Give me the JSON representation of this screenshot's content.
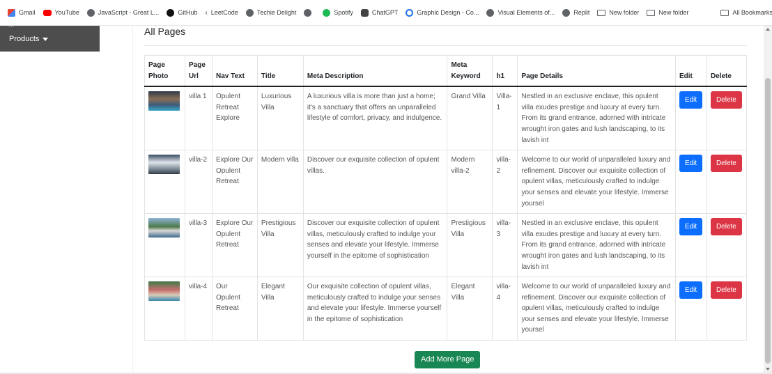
{
  "bookmarks": [
    {
      "label": "Gmail",
      "icon": "gmail-icon"
    },
    {
      "label": "YouTube",
      "icon": "youtube-icon"
    },
    {
      "label": "JavaScript - Great L...",
      "icon": "globe-icon"
    },
    {
      "label": "GitHub",
      "icon": "github-icon"
    },
    {
      "label": "LeetCode",
      "icon": "leetcode-icon"
    },
    {
      "label": "Techie Delight",
      "icon": "globe-icon"
    },
    {
      "label": "",
      "icon": "globe-icon"
    },
    {
      "label": "Spotify",
      "icon": "spotify-icon"
    },
    {
      "label": "ChatGPT",
      "icon": "chatgpt-icon"
    },
    {
      "label": "Graphic Design - Co...",
      "icon": "globe-icon"
    },
    {
      "label": "Visual Elements of...",
      "icon": "globe-icon"
    },
    {
      "label": "Replit",
      "icon": "globe-icon"
    },
    {
      "label": "New folder",
      "icon": "folder-icon"
    },
    {
      "label": "New folder",
      "icon": "folder-icon"
    }
  ],
  "all_bookmarks": "All Bookmarks",
  "sidebar": {
    "clipped_text": "...",
    "products_label": "Products"
  },
  "page": {
    "title": "All Pages",
    "add_button": "Add More Page"
  },
  "table": {
    "headers": {
      "photo": "Page Photo",
      "url": "Page Url",
      "nav": "Nav Text",
      "title": "Title",
      "meta_desc": "Meta Description",
      "meta_kw": "Meta Keyword",
      "h1": "h1",
      "details": "Page Details",
      "edit": "Edit",
      "delete": "Delete"
    },
    "rows": [
      {
        "url": "villa 1",
        "nav": "Opulent Retreat Explore",
        "title": "Luxurious Villa",
        "meta_desc": "A luxurious villa is more than just a home; it's a sanctuary that offers an unparalleled lifestyle of comfort, privacy, and indulgence.",
        "meta_kw": "Grand Villa",
        "h1": "Villa-1",
        "details": "Nestled in an exclusive enclave, this opulent villa exudes prestige and luxury at every turn. From its grand entrance, adorned with intricate wrought iron gates and lush landscaping, to its lavish int",
        "edit": "Edit",
        "delete": "Delete"
      },
      {
        "url": "villa-2",
        "nav": "Explore Our Opulent Retreat",
        "title": "Modern villa",
        "meta_desc": "Discover our exquisite collection of opulent villas.",
        "meta_kw": "Modern villa-2",
        "h1": "villa-2",
        "details": "Welcome to our world of unparalleled luxury and refinement. Discover our exquisite collection of opulent villas, meticulously crafted to indulge your senses and elevate your lifestyle. Immerse yoursel",
        "edit": "Edit",
        "delete": "Delete"
      },
      {
        "url": "villa-3",
        "nav": "Explore Our Opulent Retreat",
        "title": "Prestigious Villa",
        "meta_desc": "Discover our exquisite collection of opulent villas, meticulously crafted to indulge your senses and elevate your lifestyle. Immerse yourself in the epitome of sophistication",
        "meta_kw": "Prestigious Villa",
        "h1": "villa-3",
        "details": "Nestled in an exclusive enclave, this opulent villa exudes prestige and luxury at every turn. From its grand entrance, adorned with intricate wrought iron gates and lush landscaping, to its lavish int",
        "edit": "Edit",
        "delete": "Delete"
      },
      {
        "url": "villa-4",
        "nav": "Our Opulent Retreat",
        "title": "Elegant Villa",
        "meta_desc": "Our exquisite collection of opulent villas, meticulously crafted to indulge your senses and elevate your lifestyle. Immerse yourself in the epitome of sophistication",
        "meta_kw": "Elegant Villa",
        "h1": "villa-4",
        "details": "Welcome to our world of unparalleled luxury and refinement. Discover our exquisite collection of opulent villas, meticulously crafted to indulge your senses and elevate your lifestyle. Immerse yoursel",
        "edit": "Edit",
        "delete": "Delete"
      }
    ]
  },
  "colors": {
    "edit": "#0d6efd",
    "delete": "#dc3545",
    "add": "#198754",
    "sidebar": "#4d4d4d"
  }
}
